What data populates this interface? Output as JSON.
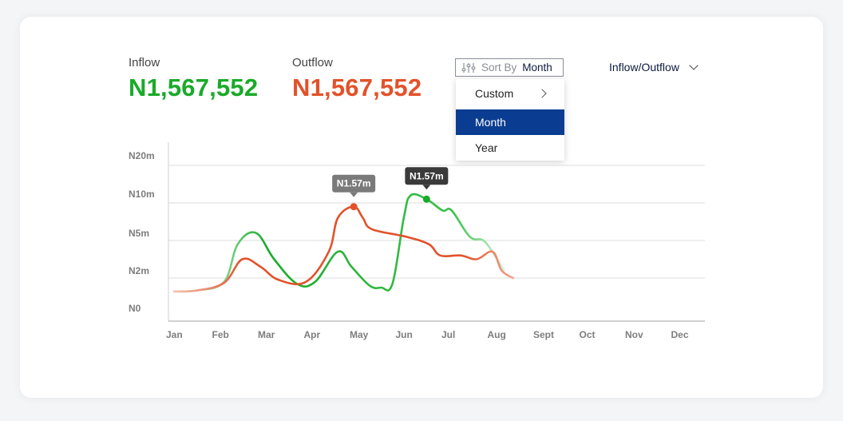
{
  "summary": {
    "inflow_label": "Inflow",
    "inflow_value": "N1,567,552",
    "outflow_label": "Outflow",
    "outflow_value": "N1,567,552"
  },
  "sort": {
    "label": "Sort By",
    "selected": "Month",
    "options": [
      "Custom",
      "Month",
      "Year"
    ]
  },
  "view_toggle": "Inflow/Outflow",
  "colors": {
    "inflow": "#1aaa2a",
    "outflow": "#e2522a",
    "accent": "#0a3d91"
  },
  "icons": {
    "sort": "sliders-icon",
    "submenu": "chevron-right-icon",
    "toggle": "chevron-down-icon"
  },
  "chart_data": {
    "type": "line",
    "title": "",
    "xlabel": "",
    "ylabel": "",
    "categories": [
      "Jan",
      "Feb",
      "Mar",
      "Apr",
      "May",
      "Jun",
      "Jul",
      "Aug",
      "Sept",
      "Oct",
      "Nov",
      "Dec"
    ],
    "y_ticks": [
      "N0",
      "N2m",
      "N5m",
      "N10m",
      "N20m"
    ],
    "grid": true,
    "series": [
      {
        "name": "Inflow",
        "color": "#1aaa2a",
        "points": [
          [
            0.0,
            0.3
          ],
          [
            0.5,
            0.35
          ],
          [
            1.1,
            0.8
          ],
          [
            1.4,
            1.9
          ],
          [
            1.8,
            2.2
          ],
          [
            2.2,
            1.5
          ],
          [
            2.7,
            0.7
          ],
          [
            3.1,
            0.8
          ],
          [
            3.6,
            1.7
          ],
          [
            3.9,
            1.3
          ],
          [
            4.3,
            0.6
          ],
          [
            4.55,
            0.5
          ],
          [
            4.8,
            0.7
          ],
          [
            5.05,
            2.6
          ],
          [
            5.2,
            3.2
          ],
          [
            5.55,
            3.1
          ],
          [
            5.9,
            2.8
          ],
          [
            6.1,
            2.8
          ],
          [
            6.5,
            2.1
          ],
          [
            6.8,
            2.0
          ],
          [
            7.05,
            1.6
          ],
          [
            7.25,
            1.2
          ]
        ]
      },
      {
        "name": "Outflow",
        "color": "#e2522a",
        "points": [
          [
            0.0,
            0.3
          ],
          [
            0.5,
            0.35
          ],
          [
            1.1,
            0.75
          ],
          [
            1.5,
            1.5
          ],
          [
            1.9,
            1.3
          ],
          [
            2.3,
            0.9
          ],
          [
            2.9,
            0.8
          ],
          [
            3.4,
            1.7
          ],
          [
            3.6,
            2.6
          ],
          [
            3.95,
            2.9
          ],
          [
            4.15,
            2.6
          ],
          [
            4.35,
            2.3
          ],
          [
            5.1,
            2.1
          ],
          [
            5.6,
            1.9
          ],
          [
            5.85,
            1.6
          ],
          [
            6.3,
            1.6
          ],
          [
            6.65,
            1.5
          ],
          [
            7.0,
            1.7
          ],
          [
            7.2,
            1.2
          ],
          [
            7.45,
            1.0
          ]
        ]
      }
    ],
    "annotations": [
      {
        "series": "Outflow",
        "x": 3.95,
        "y": 2.9,
        "label": "N1.57m"
      },
      {
        "series": "Inflow",
        "x": 5.55,
        "y": 3.1,
        "label": "N1.57m"
      }
    ],
    "note": "y values are positions on the non-linear tick scale (0=N0, 1=N2m, 2=N5m, 3=N10m, 4=N20m); x is month index (0=Jan)"
  }
}
